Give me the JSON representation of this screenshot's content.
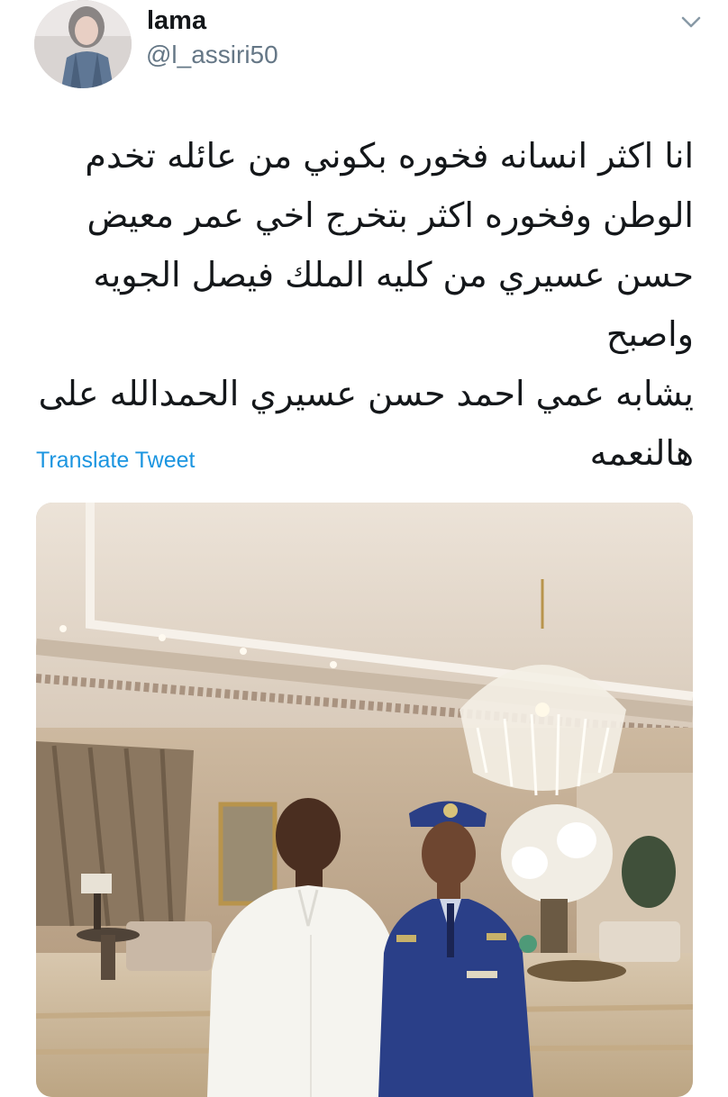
{
  "tweet": {
    "author": {
      "display_name": "lama",
      "handle": "@l_assiri50",
      "avatar_icon": "user-avatar-icon"
    },
    "menu_icon": "chevron-down-icon",
    "text": "انا اكثر انسانه فخوره بكوني من عائله تخدم\nالوطن وفخوره اكثر بتخرج اخي عمر معيض\nحسن عسيري من كليه الملك فيصل الجويه واصبح\nيشابه عمي احمد حسن عسيري  الحمدالله على\nهالنعمه",
    "translate_label": "Translate Tweet",
    "media": {
      "type": "photo",
      "icon": "photo-icon"
    }
  },
  "colors": {
    "link": "#1b95e0",
    "secondary_text": "#657786",
    "primary_text": "#14171a"
  }
}
